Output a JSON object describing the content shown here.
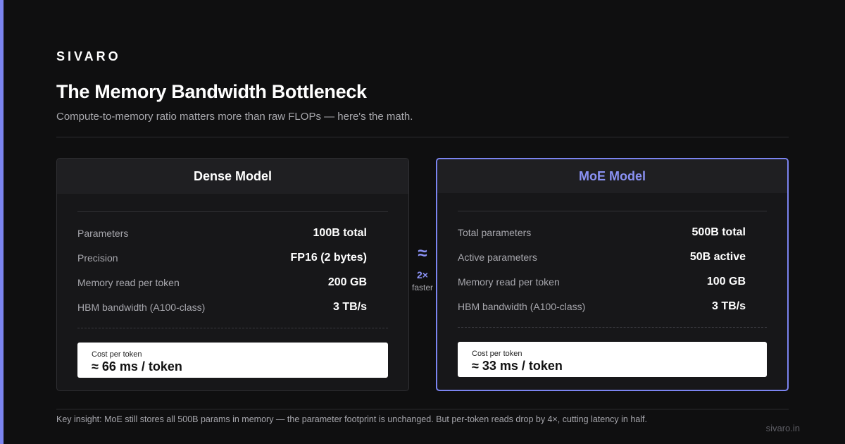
{
  "brand": "SIVARO",
  "title": "The Memory Bandwidth Bottleneck",
  "subtitle": "Compute-to-memory ratio matters more than raw FLOPs — here's the math.",
  "colors": {
    "accent": "#7b84f0",
    "background": "#0f0f10",
    "card": "#171719"
  },
  "dense": {
    "heading": "Dense Model",
    "rows": [
      {
        "label": "Parameters",
        "value": "100B total"
      },
      {
        "label": "Precision",
        "value": "FP16 (2 bytes)"
      },
      {
        "label": "Memory read per token",
        "value": "200 GB"
      },
      {
        "label": "HBM bandwidth (A100-class)",
        "value": "3 TB/s"
      }
    ],
    "cost_label": "Cost per token",
    "cost_value": "≈ 66 ms / token"
  },
  "moe": {
    "heading": "MoE Model",
    "rows": [
      {
        "label": "Total parameters",
        "value": "500B total"
      },
      {
        "label": "Active parameters",
        "value": "50B active"
      },
      {
        "label": "Memory read per token",
        "value": "100 GB"
      },
      {
        "label": "HBM bandwidth (A100-class)",
        "value": "3 TB/s"
      }
    ],
    "cost_label": "Cost per token",
    "cost_value": "≈ 33 ms / token"
  },
  "comparison": {
    "symbol": "≈",
    "speedup": "2×",
    "caption": "faster"
  },
  "footer": {
    "insight": "Key insight: MoE still stores all 500B params in memory — the parameter footprint is unchanged. But per-token reads drop by 4×, cutting latency in half.",
    "domain": "sivaro.in"
  }
}
